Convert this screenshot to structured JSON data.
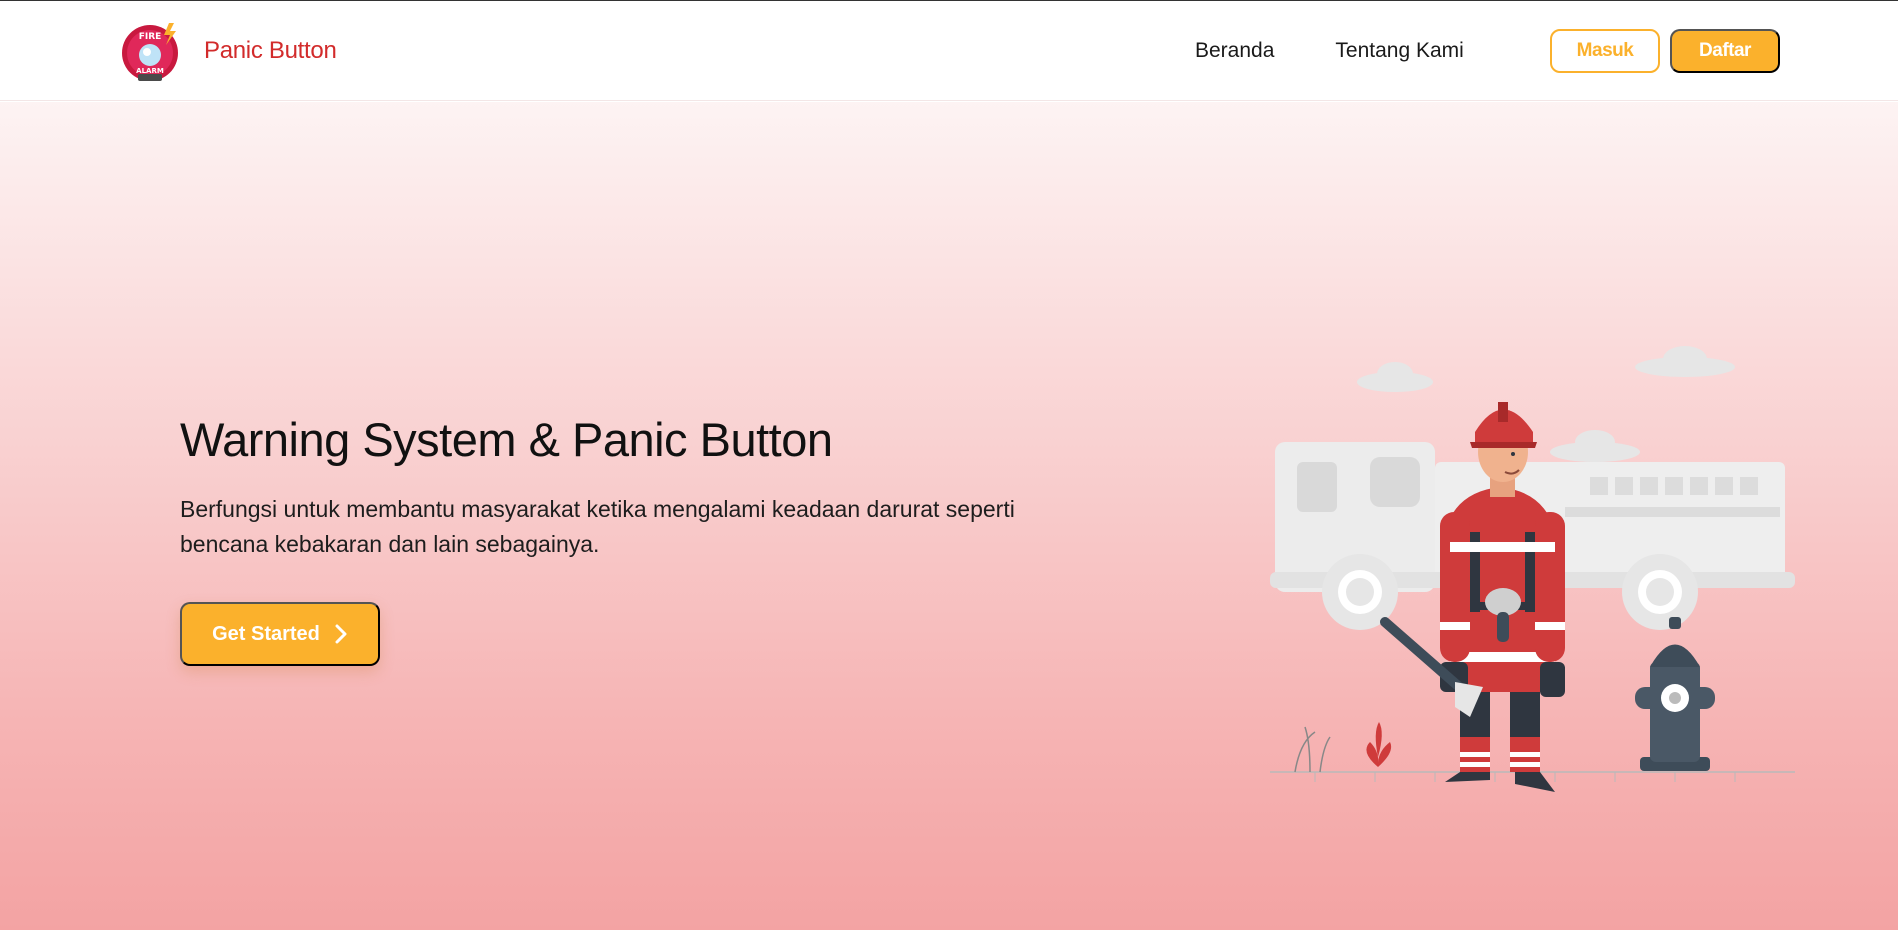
{
  "brand": {
    "name": "Panic Button",
    "logo_icon": "fire-alarm-icon"
  },
  "nav": {
    "links": [
      {
        "label": "Beranda"
      },
      {
        "label": "Tentang Kami"
      }
    ],
    "login_label": "Masuk",
    "register_label": "Daftar"
  },
  "hero": {
    "title": "Warning System & Panic Button",
    "description": "Berfungsi untuk membantu masyarakat ketika mengalami keadaan darurat seperti bencana kebakaran dan lain sebagainya.",
    "cta_label": "Get Started",
    "cta_icon": "chevron-right-icon",
    "illustration": "firefighter-illustration"
  },
  "logo_text": {
    "line1": "FIRE",
    "line2": "ALARM"
  },
  "colors": {
    "brand_red": "#d22b2b",
    "accent": "#fbb12c",
    "hero_top": "#fdf3f3",
    "hero_bottom": "#f3a3a3"
  }
}
